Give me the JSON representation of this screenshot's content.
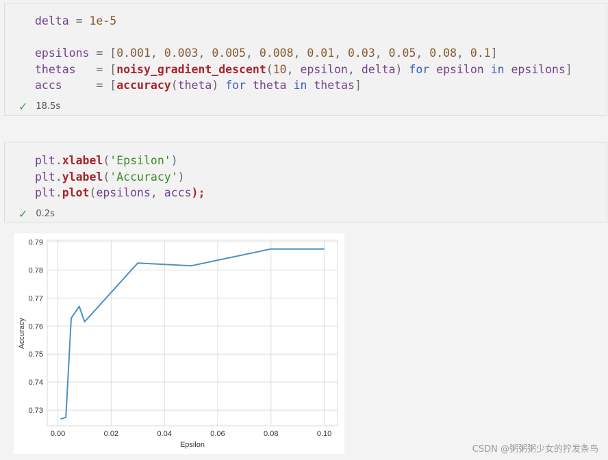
{
  "cells": [
    {
      "lines": [
        [
          {
            "t": "delta",
            "c": "var"
          },
          {
            "t": " = ",
            "c": "op"
          },
          {
            "t": "1e-5",
            "c": "num"
          }
        ],
        [],
        [
          {
            "t": "epsilons",
            "c": "var"
          },
          {
            "t": " = [",
            "c": "op"
          },
          {
            "t": "0.001",
            "c": "num"
          },
          {
            "t": ", ",
            "c": "pun"
          },
          {
            "t": "0.003",
            "c": "num"
          },
          {
            "t": ", ",
            "c": "pun"
          },
          {
            "t": "0.005",
            "c": "num"
          },
          {
            "t": ", ",
            "c": "pun"
          },
          {
            "t": "0.008",
            "c": "num"
          },
          {
            "t": ", ",
            "c": "pun"
          },
          {
            "t": "0.01",
            "c": "num"
          },
          {
            "t": ", ",
            "c": "pun"
          },
          {
            "t": "0.03",
            "c": "num"
          },
          {
            "t": ", ",
            "c": "pun"
          },
          {
            "t": "0.05",
            "c": "num"
          },
          {
            "t": ", ",
            "c": "pun"
          },
          {
            "t": "0.08",
            "c": "num"
          },
          {
            "t": ", ",
            "c": "pun"
          },
          {
            "t": "0.1",
            "c": "num"
          },
          {
            "t": "]",
            "c": "op"
          }
        ],
        [
          {
            "t": "thetas",
            "c": "var"
          },
          {
            "t": "   = [",
            "c": "op"
          },
          {
            "t": "noisy_gradient_descent",
            "c": "fn"
          },
          {
            "t": "(",
            "c": "pun"
          },
          {
            "t": "10",
            "c": "num"
          },
          {
            "t": ", ",
            "c": "pun"
          },
          {
            "t": "epsilon",
            "c": "var"
          },
          {
            "t": ", ",
            "c": "pun"
          },
          {
            "t": "delta",
            "c": "var"
          },
          {
            "t": ") ",
            "c": "pun"
          },
          {
            "t": "for",
            "c": "kw"
          },
          {
            "t": " epsilon ",
            "c": "var"
          },
          {
            "t": "in",
            "c": "kw"
          },
          {
            "t": " epsilons",
            "c": "var"
          },
          {
            "t": "]",
            "c": "op"
          }
        ],
        [
          {
            "t": "accs",
            "c": "var"
          },
          {
            "t": "     = [",
            "c": "op"
          },
          {
            "t": "accuracy",
            "c": "fn"
          },
          {
            "t": "(",
            "c": "pun"
          },
          {
            "t": "theta",
            "c": "var"
          },
          {
            "t": ") ",
            "c": "pun"
          },
          {
            "t": "for",
            "c": "kw"
          },
          {
            "t": " theta ",
            "c": "var"
          },
          {
            "t": "in",
            "c": "kw"
          },
          {
            "t": " thetas",
            "c": "var"
          },
          {
            "t": "]",
            "c": "op"
          }
        ]
      ],
      "status_icon": "check-icon",
      "exec_time": "18.5s"
    },
    {
      "lines": [
        [
          {
            "t": "plt",
            "c": "var"
          },
          {
            "t": ".",
            "c": "pun"
          },
          {
            "t": "xlabel",
            "c": "fn"
          },
          {
            "t": "(",
            "c": "pun"
          },
          {
            "t": "'Epsilon'",
            "c": "str"
          },
          {
            "t": ")",
            "c": "pun"
          }
        ],
        [
          {
            "t": "plt",
            "c": "var"
          },
          {
            "t": ".",
            "c": "pun"
          },
          {
            "t": "ylabel",
            "c": "fn"
          },
          {
            "t": "(",
            "c": "pun"
          },
          {
            "t": "'Accuracy'",
            "c": "str"
          },
          {
            "t": ")",
            "c": "pun"
          }
        ],
        [
          {
            "t": "plt",
            "c": "var"
          },
          {
            "t": ".",
            "c": "pun"
          },
          {
            "t": "plot",
            "c": "fn"
          },
          {
            "t": "(",
            "c": "pun"
          },
          {
            "t": "epsilons",
            "c": "var"
          },
          {
            "t": ", ",
            "c": "pun"
          },
          {
            "t": "accs",
            "c": "var"
          },
          {
            "t": ");",
            "c": "fn"
          }
        ]
      ],
      "status_icon": "check-icon",
      "exec_time": "0.2s"
    }
  ],
  "chart_data": {
    "type": "line",
    "x": [
      0.001,
      0.003,
      0.005,
      0.008,
      0.01,
      0.03,
      0.05,
      0.08,
      0.1
    ],
    "series": [
      {
        "values": [
          0.7268,
          0.7274,
          0.7628,
          0.767,
          0.7615,
          0.7825,
          0.7815,
          0.7875,
          0.7875
        ]
      }
    ],
    "xlabel": "Epsilon",
    "ylabel": "Accuracy",
    "xlim": [
      -0.004,
      0.105
    ],
    "ylim": [
      0.7244,
      0.7906
    ],
    "xticks": [
      "0.00",
      "0.02",
      "0.04",
      "0.06",
      "0.08",
      "0.10"
    ],
    "xtick_values": [
      0,
      0.02,
      0.04,
      0.06,
      0.08,
      0.1
    ],
    "yticks": [
      "0.73",
      "0.74",
      "0.75",
      "0.76",
      "0.77",
      "0.78",
      "0.79"
    ],
    "ytick_values": [
      0.73,
      0.74,
      0.75,
      0.76,
      0.77,
      0.78,
      0.79
    ],
    "grid": true,
    "line_color": "#4a90c8"
  },
  "watermark": "CSDN @粥粥粥少女的拧发条鸟"
}
